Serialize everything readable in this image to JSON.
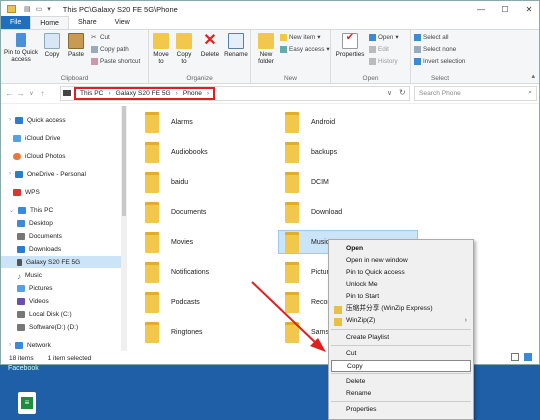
{
  "window": {
    "path_title": "This PC\\Galaxy S20 FE 5G\\Phone",
    "min": "—",
    "max": "☐",
    "close": "✕"
  },
  "tabs": [
    "File",
    "Home",
    "Share",
    "View"
  ],
  "ribbon": {
    "clipboard": {
      "label": "Clipboard",
      "pin": "Pin to Quick access",
      "copy": "Copy",
      "paste": "Paste",
      "cut": "Cut",
      "copy_path": "Copy path",
      "paste_shortcut": "Paste shortcut"
    },
    "organize": {
      "label": "Organize",
      "move_to": "Move to",
      "copy_to": "Copy to",
      "delete": "Delete",
      "rename": "Rename"
    },
    "new": {
      "label": "New",
      "new_folder": "New folder",
      "new_item": "New item",
      "easy_access": "Easy access"
    },
    "open": {
      "label": "Open",
      "properties": "Properties",
      "open": "Open",
      "edit": "Edit",
      "history": "History"
    },
    "select": {
      "label": "Select",
      "select_all": "Select all",
      "select_none": "Select none",
      "invert": "Invert selection"
    }
  },
  "address": {
    "crumbs": [
      "This PC",
      "Galaxy S20 FE 5G",
      "Phone"
    ],
    "search_placeholder": "Search Phone"
  },
  "nav": [
    {
      "label": "Quick access",
      "color": "#2b7cd3"
    },
    {
      "label": "iCloud Drive",
      "color": "#5aa0e0"
    },
    {
      "label": "iCloud Photos",
      "color": "#e57a3c"
    },
    {
      "label": "OneDrive - Personal",
      "color": "#2b7cd3"
    },
    {
      "label": "WPS",
      "color": "#d33"
    },
    {
      "label": "This PC",
      "color": "#3a8ad8"
    },
    {
      "label": "Desktop",
      "color": "#3a8ad8"
    },
    {
      "label": "Documents",
      "color": "#777"
    },
    {
      "label": "Downloads",
      "color": "#2b7cd3"
    },
    {
      "label": "Galaxy S20 FE 5G",
      "color": "#555"
    },
    {
      "label": "Music",
      "color": "#2b7cd3"
    },
    {
      "label": "Pictures",
      "color": "#5aa0e0"
    },
    {
      "label": "Videos",
      "color": "#6a4fb0"
    },
    {
      "label": "Local Disk (C:)",
      "color": "#777"
    },
    {
      "label": "Software(D:) (D:)",
      "color": "#777"
    },
    {
      "label": "Network",
      "color": "#3a8ad8"
    }
  ],
  "folders_left": [
    "Alarms",
    "Audiobooks",
    "baidu",
    "Documents",
    "Movies",
    "Notifications",
    "Podcasts",
    "Ringtones"
  ],
  "folders_right": [
    "Android",
    "backups",
    "DCIM",
    "Download",
    "Music",
    "Pictures",
    "Recordings",
    "Samsung"
  ],
  "status": {
    "count": "18 items",
    "selected": "1 item selected"
  },
  "context_menu": {
    "open": "Open",
    "open_new_window": "Open in new window",
    "pin_quick": "Pin to Quick access",
    "unlock": "Unlock Me",
    "pin_start": "Pin to Start",
    "compress": "压缩并分享 (WinZip Express)",
    "winzip": "WinZip(Z)",
    "create_playlist": "Create Playlist",
    "cut": "Cut",
    "copy": "Copy",
    "delete": "Delete",
    "rename": "Rename",
    "properties": "Properties"
  },
  "desktop": {
    "label": "Facebook"
  }
}
